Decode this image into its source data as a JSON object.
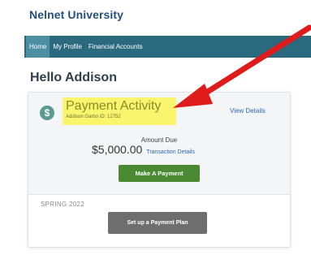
{
  "header": {
    "brand": "Nelnet University"
  },
  "nav": {
    "tabs": [
      {
        "label": "Home",
        "active": true
      },
      {
        "label": "My Profile",
        "active": false
      },
      {
        "label": "Financial Accounts",
        "active": false
      }
    ]
  },
  "greeting": "Hello Addison",
  "payment_card": {
    "icon": "dollar-icon",
    "title": "Payment Activity",
    "subtitle": "Addison Garbo ID: 12752",
    "view_details": "View Details",
    "amount_due_label": "Amount Due",
    "amount_due_value": "$5,000.00",
    "transaction_details": "Transaction Details",
    "make_payment_label": "Make A Payment",
    "term": "SPRING 2022",
    "payment_plan_label": "Set up a Payment Plan"
  },
  "colors": {
    "nav_bg": "#2b6a7e",
    "highlight": "#faf56c",
    "pay_button": "#4a8a33",
    "plan_button": "#6e6e6e",
    "arrow": "#e01b1b"
  }
}
